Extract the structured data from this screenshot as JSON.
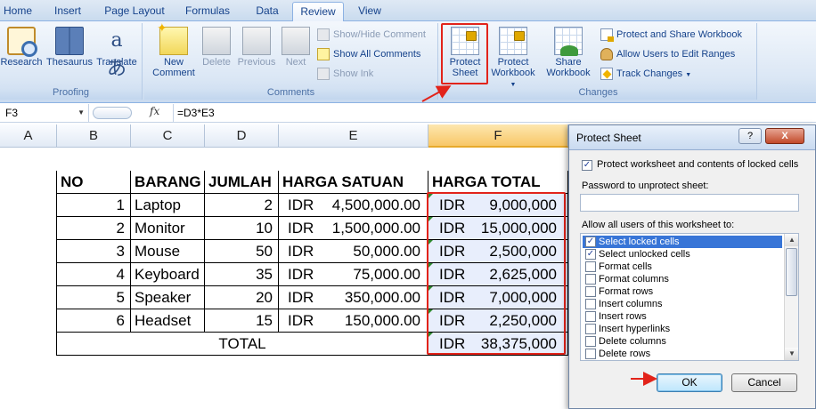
{
  "tabs": [
    "Home",
    "Insert",
    "Page Layout",
    "Formulas",
    "Data",
    "Review",
    "View"
  ],
  "active_tab": "Review",
  "ribbon": {
    "proofing": {
      "label": "Proofing",
      "research": "Research",
      "thesaurus": "Thesaurus",
      "translate": "Translate"
    },
    "comments": {
      "label": "Comments",
      "new_comment_line1": "New",
      "new_comment_line2": "Comment",
      "delete": "Delete",
      "previous": "Previous",
      "next": "Next",
      "show_hide": "Show/Hide Comment",
      "show_all": "Show All Comments",
      "show_ink": "Show Ink"
    },
    "changes": {
      "label": "Changes",
      "protect_sheet_line1": "Protect",
      "protect_sheet_line2": "Sheet",
      "protect_workbook_line1": "Protect",
      "protect_workbook_line2": "Workbook",
      "share_workbook_line1": "Share",
      "share_workbook_line2": "Workbook",
      "protect_share": "Protect and Share Workbook",
      "allow_users": "Allow Users to Edit Ranges",
      "track_changes": "Track Changes"
    }
  },
  "formula_bar": {
    "cell_ref": "F3",
    "fx": "fx",
    "formula": "=D3*E3"
  },
  "columns": [
    "A",
    "B",
    "C",
    "D",
    "E",
    "F"
  ],
  "table": {
    "headers": [
      "NO",
      "BARANG",
      "JUMLAH",
      "HARGA SATUAN",
      "HARGA TOTAL"
    ],
    "rows": [
      {
        "no": "1",
        "barang": "Laptop",
        "jumlah": "2",
        "cur": "IDR",
        "satuan": "4,500,000.00",
        "cur2": "IDR",
        "total": "9,000,000"
      },
      {
        "no": "2",
        "barang": "Monitor",
        "jumlah": "10",
        "cur": "IDR",
        "satuan": "1,500,000.00",
        "cur2": "IDR",
        "total": "15,000,000"
      },
      {
        "no": "3",
        "barang": "Mouse",
        "jumlah": "50",
        "cur": "IDR",
        "satuan": "50,000.00",
        "cur2": "IDR",
        "total": "2,500,000"
      },
      {
        "no": "4",
        "barang": "Keyboard",
        "jumlah": "35",
        "cur": "IDR",
        "satuan": "75,000.00",
        "cur2": "IDR",
        "total": "2,625,000"
      },
      {
        "no": "5",
        "barang": "Speaker",
        "jumlah": "20",
        "cur": "IDR",
        "satuan": "350,000.00",
        "cur2": "IDR",
        "total": "7,000,000"
      },
      {
        "no": "6",
        "barang": "Headset",
        "jumlah": "15",
        "cur": "IDR",
        "satuan": "150,000.00",
        "cur2": "IDR",
        "total": "2,250,000"
      }
    ],
    "total_label": "TOTAL",
    "total_cur": "IDR",
    "total_value": "38,375,000"
  },
  "dialog": {
    "title": "Protect Sheet",
    "help": "?",
    "close": "X",
    "protect_label": "Protect worksheet and contents of locked cells",
    "password_label": "Password to unprotect sheet:",
    "password_value": "",
    "allow_label": "Allow all users of this worksheet to:",
    "options": [
      {
        "label": "Select locked cells",
        "checked": true,
        "selected": true
      },
      {
        "label": "Select unlocked cells",
        "checked": true,
        "selected": false
      },
      {
        "label": "Format cells",
        "checked": false,
        "selected": false
      },
      {
        "label": "Format columns",
        "checked": false,
        "selected": false
      },
      {
        "label": "Format rows",
        "checked": false,
        "selected": false
      },
      {
        "label": "Insert columns",
        "checked": false,
        "selected": false
      },
      {
        "label": "Insert rows",
        "checked": false,
        "selected": false
      },
      {
        "label": "Insert hyperlinks",
        "checked": false,
        "selected": false
      },
      {
        "label": "Delete columns",
        "checked": false,
        "selected": false
      },
      {
        "label": "Delete rows",
        "checked": false,
        "selected": false
      }
    ],
    "ok": "OK",
    "cancel": "Cancel"
  },
  "colors": {
    "highlight": "#e2231a",
    "ribbon_text": "#15428b"
  }
}
